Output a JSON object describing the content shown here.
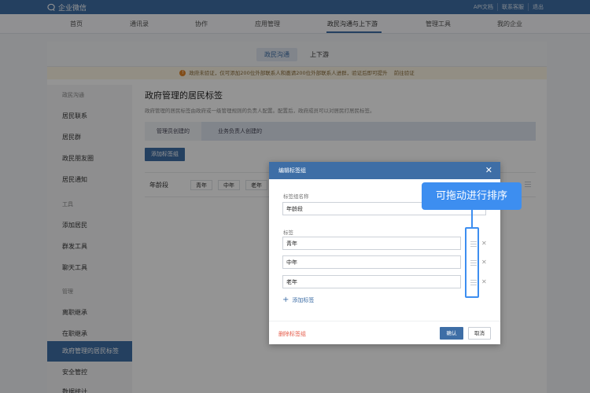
{
  "topbar": {
    "logo_text": "企业微信",
    "links": [
      "API文档",
      "联系客服",
      "退出"
    ]
  },
  "nav": {
    "items": [
      "首页",
      "通讯录",
      "协作",
      "应用管理",
      "政民沟通与上下游",
      "管理工具",
      "我的企业"
    ],
    "active": "政民沟通与上下游"
  },
  "subtabs": {
    "items": [
      "政民沟通",
      "上下游"
    ],
    "active": "政民沟通"
  },
  "notice": {
    "text": "政府未验证，仅可添加200位外部联系人和邀请200位外部联系人进群，验证后即可提升",
    "link": "前往验证"
  },
  "sidebar": {
    "items": [
      {
        "label": "政民沟通",
        "type": "section"
      },
      {
        "label": "居民联系",
        "type": "item"
      },
      {
        "label": "居民群",
        "type": "item"
      },
      {
        "label": "政民朋友圈",
        "type": "item"
      },
      {
        "label": "居民通知",
        "type": "item"
      },
      {
        "label": "工具",
        "type": "section"
      },
      {
        "label": "添加居民",
        "type": "item"
      },
      {
        "label": "群发工具",
        "type": "item"
      },
      {
        "label": "聊天工具",
        "type": "item"
      },
      {
        "label": "管理",
        "type": "section"
      },
      {
        "label": "离职继承",
        "type": "item"
      },
      {
        "label": "在职继承",
        "type": "item"
      },
      {
        "label": "政府管理的居民标签",
        "type": "active"
      },
      {
        "label": "安全管控",
        "type": "item"
      },
      {
        "label": "数据统计",
        "type": "item"
      }
    ]
  },
  "content": {
    "title": "政府管理的居民标签",
    "description": "政府管理的居民标签由政府或一级管理规则的负责人配置。配置后，政府成员可以对居民打居民标签。",
    "tabs": [
      "管理员创建的",
      "业务负责人创建的"
    ],
    "active_tab": "管理员创建的",
    "add_group_label": "添加标签组",
    "group": {
      "name": "年龄段",
      "tags": [
        "青年",
        "中年",
        "老年"
      ]
    }
  },
  "modal": {
    "title": "编辑标签组",
    "group_name_label": "标签组名称",
    "group_name_value": "年龄段",
    "tags_label": "标签",
    "tags": [
      "青年",
      "中年",
      "老年"
    ],
    "add_tag_label": "添加标签",
    "delete_group_label": "删除标签组",
    "confirm_label": "确认",
    "cancel_label": "取消"
  },
  "annotation": {
    "callout_text": "可拖动进行排序",
    "highlight_color": "#3d8ef0"
  },
  "colors": {
    "brand": "#3e6ea6",
    "danger": "#e55c4a",
    "notice_bg": "#fcf5e4"
  }
}
